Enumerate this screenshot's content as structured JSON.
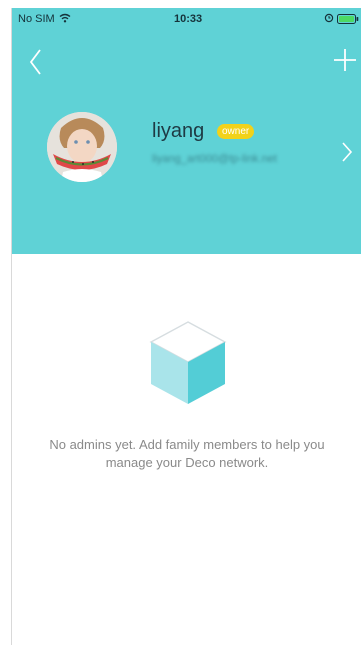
{
  "status_bar": {
    "carrier": "No SIM",
    "time": "10:33"
  },
  "header": {
    "background": "#5fd2d6",
    "icons": [
      "back-icon",
      "plus-icon",
      "chevron-right-icon"
    ]
  },
  "profile": {
    "name": "liyang",
    "badge": "owner",
    "email": "liyang_art000@tp-link.net"
  },
  "empty_state": {
    "icon": "box-icon",
    "message": "No admins yet. Add family members to help you manage your Deco network."
  },
  "colors": {
    "accent": "#5fd2d6",
    "badge": "#f2d21a"
  }
}
